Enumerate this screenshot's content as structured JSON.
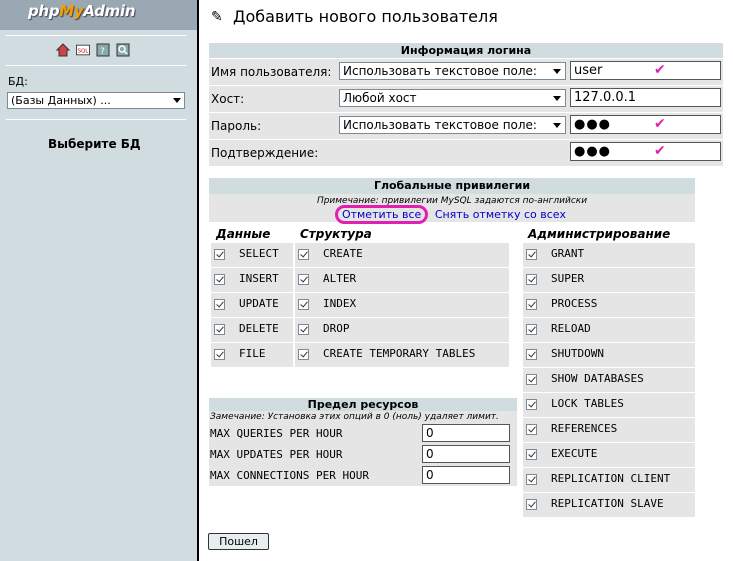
{
  "sidebar": {
    "logo_php": "php",
    "logo_my": "My",
    "logo_admin": "Admin",
    "db_label": "БД:",
    "db_selected": "(Базы Данных) ...",
    "choose_db": "Выберите БД",
    "icons": [
      "home-icon",
      "sql-icon",
      "docs-icon",
      "help-icon"
    ]
  },
  "main": {
    "title": "Добавить нового пользователя",
    "login": {
      "heading": "Информация логина",
      "rows": [
        {
          "label": "Имя пользователя:",
          "select": "Использовать текстовое поле:",
          "value": "user"
        },
        {
          "label": "Хост:",
          "select": "Любой хост",
          "value": "127.0.0.1"
        },
        {
          "label": "Пароль:",
          "select": "Использовать текстовое поле:",
          "value": "●●●"
        },
        {
          "label": "Подтверждение:",
          "value": "●●●"
        }
      ]
    },
    "privileges": {
      "heading": "Глобальные привилегии",
      "note": "Примечание: привилегии MySQL задаются по-английски",
      "check_all": "Отметить все",
      "uncheck_all": "Снять отметку со всех",
      "groups": {
        "data": {
          "label": "Данные",
          "items": [
            "SELECT",
            "INSERT",
            "UPDATE",
            "DELETE",
            "FILE"
          ]
        },
        "structure": {
          "label": "Структура",
          "items": [
            "CREATE",
            "ALTER",
            "INDEX",
            "DROP",
            "CREATE TEMPORARY TABLES"
          ]
        },
        "admin": {
          "label": "Администрирование",
          "items": [
            "GRANT",
            "SUPER",
            "PROCESS",
            "RELOAD",
            "SHUTDOWN",
            "SHOW DATABASES",
            "LOCK TABLES",
            "REFERENCES",
            "EXECUTE",
            "REPLICATION CLIENT",
            "REPLICATION SLAVE"
          ]
        }
      }
    },
    "resources": {
      "heading": "Предел ресурсов",
      "note": "Замечание: Установка этих опций в 0 (ноль) удаляет лимит.",
      "rows": [
        {
          "label": "MAX QUERIES PER HOUR",
          "value": "0"
        },
        {
          "label": "MAX UPDATES PER HOUR",
          "value": "0"
        },
        {
          "label": "MAX CONNECTIONS PER HOUR",
          "value": "0"
        }
      ]
    },
    "go_label": "Пошел"
  }
}
